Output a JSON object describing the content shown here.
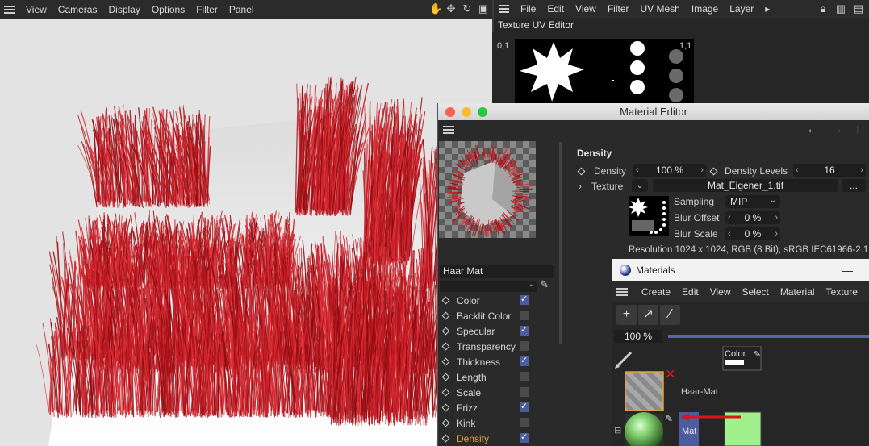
{
  "viewport": {
    "menu": [
      "View",
      "Cameras",
      "Display",
      "Options",
      "Filter",
      "Panel"
    ],
    "tool_icons": [
      "hand-icon",
      "move-icon",
      "rotate-icon",
      "maximize-icon"
    ]
  },
  "uv_editor": {
    "menu": [
      "File",
      "Edit",
      "View",
      "Filter",
      "UV Mesh",
      "Image",
      "Layer"
    ],
    "overflow": "▸",
    "title": "Texture UV Editor",
    "corner_left": "0,1",
    "corner_right": "1,1"
  },
  "material_editor": {
    "title": "Material Editor",
    "material_name": "Haar Mat",
    "channels": [
      {
        "label": "Color",
        "checked": true
      },
      {
        "label": "Backlit Color",
        "checked": false
      },
      {
        "label": "Specular",
        "checked": true
      },
      {
        "label": "Transparency",
        "checked": false
      },
      {
        "label": "Thickness",
        "checked": true
      },
      {
        "label": "Length",
        "checked": false
      },
      {
        "label": "Scale",
        "checked": false
      },
      {
        "label": "Frizz",
        "checked": true
      },
      {
        "label": "Kink",
        "checked": false
      },
      {
        "label": "Density",
        "checked": true,
        "active": true
      }
    ],
    "section": "Density",
    "density_label": "Density",
    "density_value": "100 %",
    "density_levels_label": "Density Levels",
    "density_levels_value": "16",
    "texture_label": "Texture",
    "texture_file": "Mat_Eigener_1.tif",
    "texture_more": "...",
    "sampling_label": "Sampling",
    "sampling_value": "MIP",
    "blur_offset_label": "Blur Offset",
    "blur_offset_value": "0 %",
    "blur_scale_label": "Blur Scale",
    "blur_scale_value": "0 %",
    "resolution": "Resolution 1024 x 1024, RGB (8 Bit), sRGB IEC61966-2.1"
  },
  "materials_manager": {
    "title": "Materials",
    "minimize": "—",
    "menu": [
      "Create",
      "Edit",
      "View",
      "Select",
      "Material",
      "Texture"
    ],
    "zoom": "100 %",
    "color_node_label": "Color",
    "haar_mat_label": "Haar-Mat",
    "mat_label": "Mat"
  },
  "colors": {
    "hair_red": "#c0141c",
    "accent_blue": "#4b5d9f",
    "active_orange": "#e6a23a",
    "link_red": "#d8161c",
    "swatch_green": "#a0f08c"
  }
}
